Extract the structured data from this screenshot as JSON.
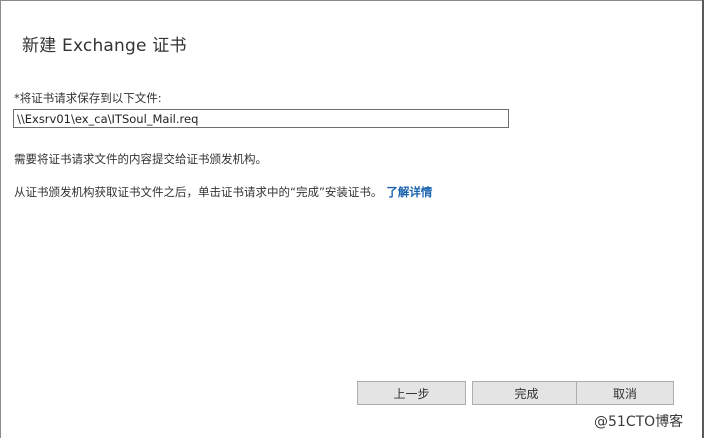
{
  "dialog": {
    "title": "新建 Exchange 证书"
  },
  "form": {
    "path_label": "*将证书请求保存到以下文件:",
    "path_value": "\\\\Exsrv01\\ex_ca\\ITSoul_Mail.req"
  },
  "info": {
    "line1": "需要将证书请求文件的内容提交给证书颁发机构。",
    "line2": "从证书颁发机构获取证书文件之后，单击证书请求中的“完成”安装证书。",
    "learn_more": "了解详情"
  },
  "buttons": {
    "back": "上一步",
    "finish": "完成",
    "cancel": "取消"
  },
  "watermark": "@51CTO博客",
  "colors": {
    "link": "#1a64b0",
    "button_bg": "#e4e4e4",
    "button_border": "#adadad"
  }
}
